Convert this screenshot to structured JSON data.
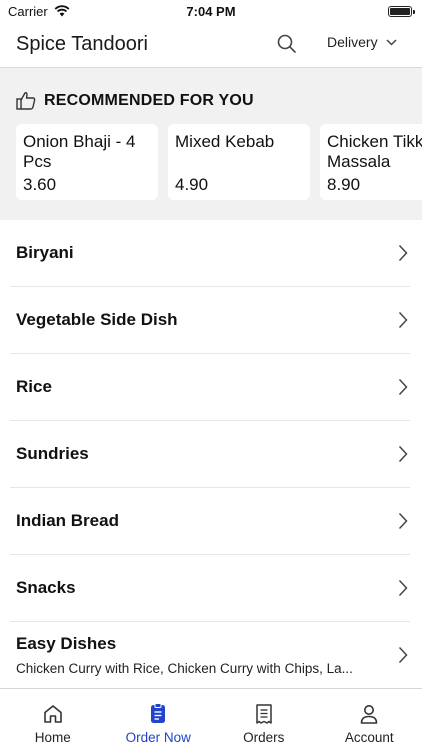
{
  "status_bar": {
    "carrier": "Carrier",
    "time": "7:04 PM"
  },
  "header": {
    "title": "Spice Tandoori",
    "delivery_mode": "Delivery"
  },
  "recommended": {
    "title": "RECOMMENDED FOR YOU",
    "items": [
      {
        "name": "Onion Bhaji - 4 Pcs",
        "price": "3.60"
      },
      {
        "name": "Mixed Kebab",
        "price": "4.90"
      },
      {
        "name": "Chicken Tikka Massala",
        "price": "8.90"
      }
    ]
  },
  "categories": [
    {
      "label": "Biryani"
    },
    {
      "label": "Vegetable Side Dish"
    },
    {
      "label": "Rice"
    },
    {
      "label": "Sundries"
    },
    {
      "label": "Indian Bread"
    },
    {
      "label": "Snacks"
    },
    {
      "label": "Easy Dishes",
      "subtitle": "Chicken Curry with Rice, Chicken Curry with Chips, La..."
    }
  ],
  "tabs": [
    {
      "label": "Home",
      "icon": "home-icon"
    },
    {
      "label": "Order Now",
      "icon": "order-icon",
      "active": true
    },
    {
      "label": "Orders",
      "icon": "receipt-icon"
    },
    {
      "label": "Account",
      "icon": "account-icon"
    }
  ],
  "colors": {
    "accent": "#2244cc",
    "section_bg": "#f1f1f1"
  }
}
